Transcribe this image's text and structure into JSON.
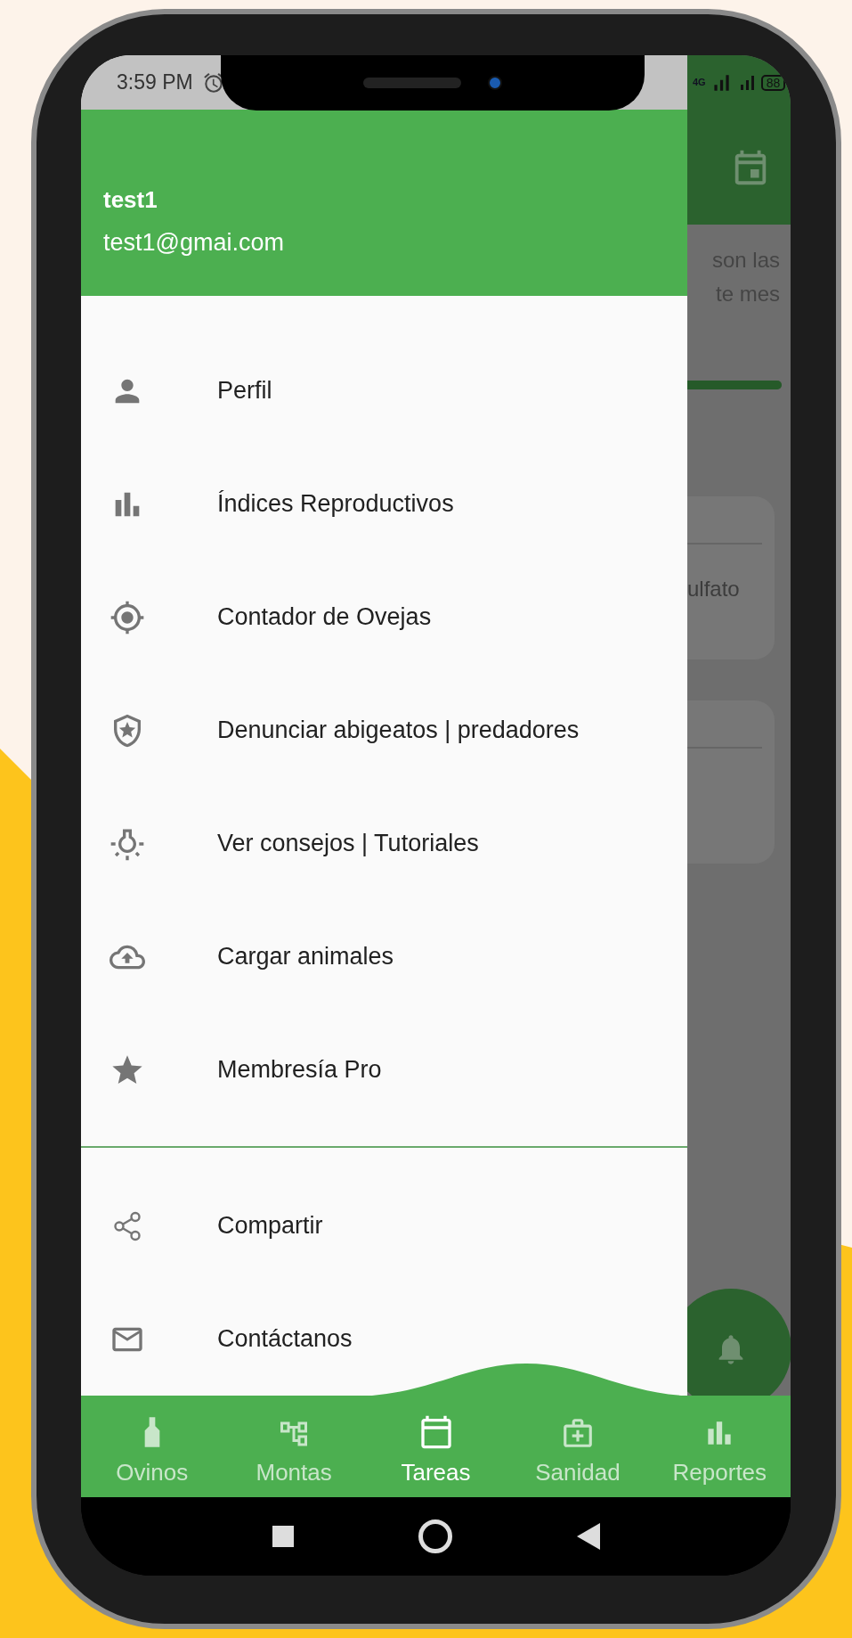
{
  "status_bar": {
    "time": "3:59 PM",
    "network": "4G",
    "battery": "88"
  },
  "drawer": {
    "user_name": "test1",
    "user_email": "test1@gmai.com",
    "items": [
      {
        "label": "Perfil",
        "kind": "person"
      },
      {
        "label": "Índices Reproductivos",
        "kind": "chart"
      },
      {
        "label": "Contador de Ovejas",
        "kind": "target"
      },
      {
        "label": "Denunciar abigeatos | predadores",
        "kind": "shield"
      },
      {
        "label": "Ver consejos | Tutoriales",
        "kind": "bulb"
      },
      {
        "label": "Cargar animales",
        "kind": "upload"
      },
      {
        "label": "Membresía Pro",
        "kind": "star"
      }
    ],
    "secondary_items": [
      {
        "label": "Compartir",
        "kind": "share"
      },
      {
        "label": "Contáctanos",
        "kind": "mail"
      }
    ]
  },
  "background_screen": {
    "heading_lines": [
      "son las",
      "te mes"
    ],
    "progress": {
      "level": 1
    },
    "cards": [
      {
        "kind": "text",
        "text": "ulfato"
      },
      {
        "kind": "blank"
      }
    ]
  },
  "bottom_nav": [
    {
      "label": "Ovinos",
      "kind": "tag",
      "selected": false
    },
    {
      "label": "Montas",
      "kind": "tree",
      "selected": false
    },
    {
      "label": "Tareas",
      "kind": "calendar",
      "selected": true
    },
    {
      "label": "Sanidad",
      "kind": "medical",
      "selected": false
    },
    {
      "label": "Reportes",
      "kind": "chart",
      "selected": false
    }
  ]
}
